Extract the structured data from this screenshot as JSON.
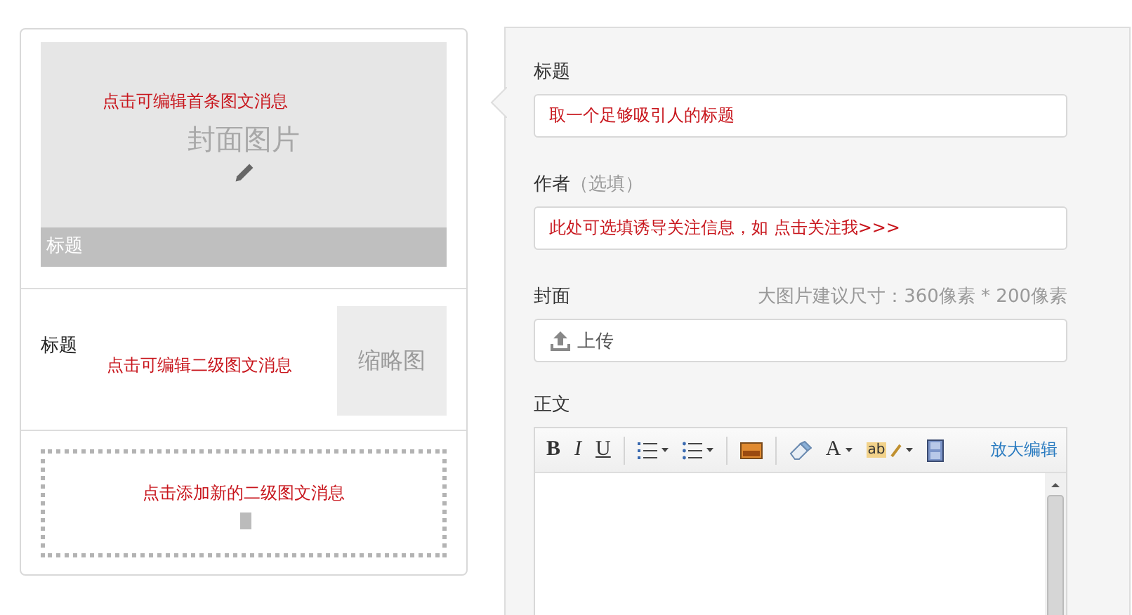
{
  "cover_panel": {
    "cover_placeholder": "封面图片",
    "title": "标题",
    "annotation": "点击可编辑首条图文消息"
  },
  "sub_item": {
    "title": "标题",
    "thumbnail": "缩略图",
    "annotation": "点击可编辑二级图文消息"
  },
  "add_item": {
    "annotation": "点击添加新的二级图文消息"
  },
  "form": {
    "fields": [
      {
        "label": "标题",
        "value": "取一个足够吸引人的标题"
      },
      {
        "label": "作者",
        "note": "（选填）",
        "value": "此处可选填诱导关注信息，如 点击关注我>>>"
      }
    ],
    "cover": {
      "label": "封面",
      "hint": "大图片建议尺寸：360像素 * 200像素",
      "upload": "上传"
    },
    "body": {
      "label": "正文",
      "expand_link": "放大编辑",
      "toolbar": [
        {
          "kind": "bold",
          "text": "B"
        },
        {
          "kind": "italic",
          "text": "I"
        },
        {
          "kind": "underline",
          "text": "U"
        },
        {
          "kind": "separator"
        },
        {
          "kind": "ordered-list",
          "dropdown": true
        },
        {
          "kind": "bullet-list",
          "dropdown": true
        },
        {
          "kind": "separator"
        },
        {
          "kind": "image",
          "dropdown": false
        },
        {
          "kind": "separator"
        },
        {
          "kind": "eraser",
          "dropdown": false
        },
        {
          "kind": "font-color",
          "text": "A",
          "dropdown": true
        },
        {
          "kind": "highlight",
          "text": "ab",
          "dropdown": true
        },
        {
          "kind": "film",
          "dropdown": false
        }
      ]
    }
  }
}
